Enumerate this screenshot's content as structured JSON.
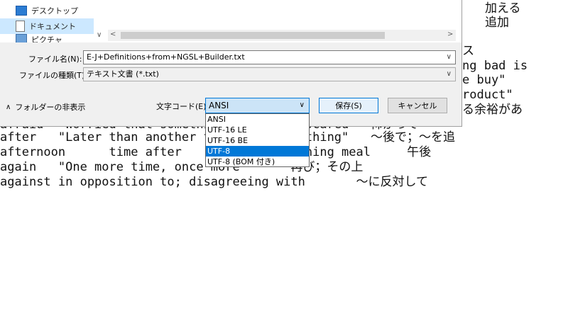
{
  "editor": {
    "lines": [
      "加える",
      "追加",
      "ス",
      "ng bad is",
      "e buy\"",
      "roduct\"",
      "る余裕があ",
      "afraid  \"Worried that somethi      appen, scared   怖がって",
      "after   \"Later than another t      nd something\"   ～後で；～を追",
      "afternoon      time after       re the evening meal     午後",
      "again   \"One more time, once more       再び；その上",
      "against in opposition to; disagreeing with       ～に反対して"
    ]
  },
  "dialog": {
    "tree_items": [
      {
        "label": "デスクトップ",
        "icon": "desktop-icon"
      },
      {
        "label": "ドキュメント",
        "icon": "documents-icon"
      },
      {
        "label": "ピクチャ",
        "icon": "pictures-icon"
      }
    ],
    "filename_label": "ファイル名(N):",
    "filename_value": "E-J+Definitions+from+NGSL+Builder.txt",
    "filetype_label": "ファイルの種類(T):",
    "filetype_value": "テキスト文書 (*.txt)",
    "hide_folders_label": "フォルダーの非表示",
    "encoding_label": "文字コード(E):",
    "encoding_selected": "ANSI",
    "encoding_options": [
      "ANSI",
      "UTF-16 LE",
      "UTF-16 BE",
      "UTF-8",
      "UTF-8 (BOM 付き)"
    ],
    "encoding_highlighted_index": 3,
    "save_label": "保存(S)",
    "cancel_label": "キャンセル"
  },
  "colors": {
    "selection": "#0078d7",
    "dialog_bg": "#f0f0f0",
    "tree_selected": "#cce8ff"
  }
}
